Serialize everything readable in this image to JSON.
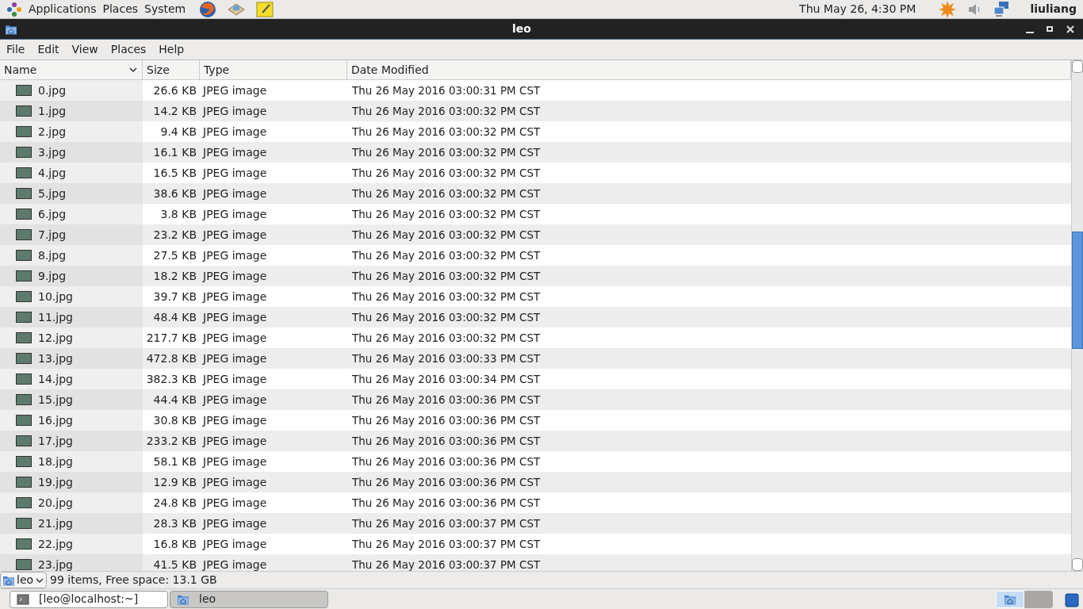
{
  "top_panel": {
    "menus": [
      "Applications",
      "Places",
      "System"
    ],
    "clock": "Thu May 26,  4:30 PM",
    "user": "liuliang"
  },
  "window": {
    "title": "leo"
  },
  "menubar": [
    "File",
    "Edit",
    "View",
    "Places",
    "Help"
  ],
  "columns": [
    {
      "label": "Name",
      "sorted": true
    },
    {
      "label": "Size",
      "sorted": false
    },
    {
      "label": "Type",
      "sorted": false
    },
    {
      "label": "Date Modified",
      "sorted": false
    }
  ],
  "rows": [
    {
      "name": "0.jpg",
      "size": "26.6 KB",
      "type": "JPEG image",
      "date": "Thu 26 May 2016 03:00:31 PM CST"
    },
    {
      "name": "1.jpg",
      "size": "14.2 KB",
      "type": "JPEG image",
      "date": "Thu 26 May 2016 03:00:32 PM CST"
    },
    {
      "name": "2.jpg",
      "size": "9.4 KB",
      "type": "JPEG image",
      "date": "Thu 26 May 2016 03:00:32 PM CST"
    },
    {
      "name": "3.jpg",
      "size": "16.1 KB",
      "type": "JPEG image",
      "date": "Thu 26 May 2016 03:00:32 PM CST"
    },
    {
      "name": "4.jpg",
      "size": "16.5 KB",
      "type": "JPEG image",
      "date": "Thu 26 May 2016 03:00:32 PM CST"
    },
    {
      "name": "5.jpg",
      "size": "38.6 KB",
      "type": "JPEG image",
      "date": "Thu 26 May 2016 03:00:32 PM CST"
    },
    {
      "name": "6.jpg",
      "size": "3.8 KB",
      "type": "JPEG image",
      "date": "Thu 26 May 2016 03:00:32 PM CST"
    },
    {
      "name": "7.jpg",
      "size": "23.2 KB",
      "type": "JPEG image",
      "date": "Thu 26 May 2016 03:00:32 PM CST"
    },
    {
      "name": "8.jpg",
      "size": "27.5 KB",
      "type": "JPEG image",
      "date": "Thu 26 May 2016 03:00:32 PM CST"
    },
    {
      "name": "9.jpg",
      "size": "18.2 KB",
      "type": "JPEG image",
      "date": "Thu 26 May 2016 03:00:32 PM CST"
    },
    {
      "name": "10.jpg",
      "size": "39.7 KB",
      "type": "JPEG image",
      "date": "Thu 26 May 2016 03:00:32 PM CST"
    },
    {
      "name": "11.jpg",
      "size": "48.4 KB",
      "type": "JPEG image",
      "date": "Thu 26 May 2016 03:00:32 PM CST"
    },
    {
      "name": "12.jpg",
      "size": "217.7 KB",
      "type": "JPEG image",
      "date": "Thu 26 May 2016 03:00:32 PM CST"
    },
    {
      "name": "13.jpg",
      "size": "472.8 KB",
      "type": "JPEG image",
      "date": "Thu 26 May 2016 03:00:33 PM CST"
    },
    {
      "name": "14.jpg",
      "size": "382.3 KB",
      "type": "JPEG image",
      "date": "Thu 26 May 2016 03:00:34 PM CST"
    },
    {
      "name": "15.jpg",
      "size": "44.4 KB",
      "type": "JPEG image",
      "date": "Thu 26 May 2016 03:00:36 PM CST"
    },
    {
      "name": "16.jpg",
      "size": "30.8 KB",
      "type": "JPEG image",
      "date": "Thu 26 May 2016 03:00:36 PM CST"
    },
    {
      "name": "17.jpg",
      "size": "233.2 KB",
      "type": "JPEG image",
      "date": "Thu 26 May 2016 03:00:36 PM CST"
    },
    {
      "name": "18.jpg",
      "size": "58.1 KB",
      "type": "JPEG image",
      "date": "Thu 26 May 2016 03:00:36 PM CST"
    },
    {
      "name": "19.jpg",
      "size": "12.9 KB",
      "type": "JPEG image",
      "date": "Thu 26 May 2016 03:00:36 PM CST"
    },
    {
      "name": "20.jpg",
      "size": "24.8 KB",
      "type": "JPEG image",
      "date": "Thu 26 May 2016 03:00:36 PM CST"
    },
    {
      "name": "21.jpg",
      "size": "28.3 KB",
      "type": "JPEG image",
      "date": "Thu 26 May 2016 03:00:37 PM CST"
    },
    {
      "name": "22.jpg",
      "size": "16.8 KB",
      "type": "JPEG image",
      "date": "Thu 26 May 2016 03:00:37 PM CST"
    },
    {
      "name": "23.jpg",
      "size": "41.5 KB",
      "type": "JPEG image",
      "date": "Thu 26 May 2016 03:00:37 PM CST"
    }
  ],
  "status_bar": {
    "location": "leo",
    "info": "99 items, Free space: 13.1 GB"
  },
  "taskbar": {
    "windows": [
      {
        "label": "[leo@localhost:~]",
        "kind": "terminal",
        "selected": false
      },
      {
        "label": "leo",
        "kind": "folder",
        "selected": true
      }
    ],
    "workspaces": [
      {
        "selected": true
      },
      {
        "selected": false
      }
    ]
  }
}
